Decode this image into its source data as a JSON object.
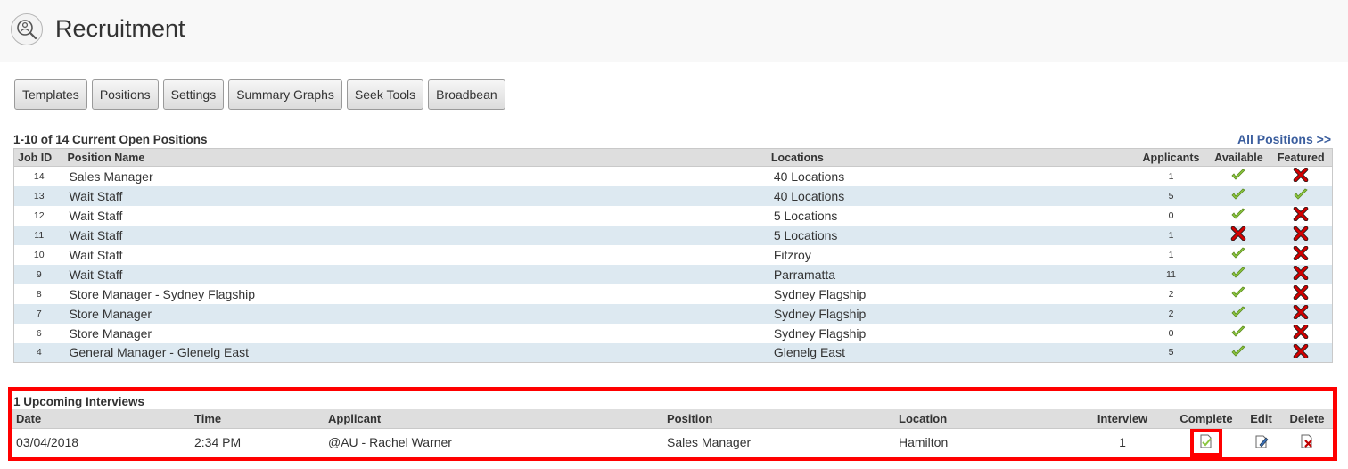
{
  "header": {
    "title": "Recruitment",
    "icon": "recruitment-search-person-icon"
  },
  "toolbar": {
    "buttons": [
      "Templates",
      "Positions",
      "Settings",
      "Summary Graphs",
      "Seek Tools",
      "Broadbean"
    ]
  },
  "positions": {
    "caption": "1-10 of 14 Current Open Positions",
    "all_link": "All Positions >>",
    "columns": {
      "job_id": "Job ID",
      "name": "Position Name",
      "locations": "Locations",
      "applicants": "Applicants",
      "available": "Available",
      "featured": "Featured"
    },
    "rows": [
      {
        "job_id": "14",
        "name": "Sales Manager",
        "locations": "40 Locations",
        "applicants": "1",
        "available": "check-icon",
        "featured": "cross-icon"
      },
      {
        "job_id": "13",
        "name": "Wait Staff",
        "locations": "40 Locations",
        "applicants": "5",
        "available": "check-icon",
        "featured": "check-icon"
      },
      {
        "job_id": "12",
        "name": "Wait Staff",
        "locations": "5 Locations",
        "applicants": "0",
        "available": "check-icon",
        "featured": "cross-icon"
      },
      {
        "job_id": "11",
        "name": "Wait Staff",
        "locations": "5 Locations",
        "applicants": "1",
        "available": "cross-icon",
        "featured": "cross-icon"
      },
      {
        "job_id": "10",
        "name": "Wait Staff",
        "locations": "Fitzroy",
        "applicants": "1",
        "available": "check-icon",
        "featured": "cross-icon"
      },
      {
        "job_id": "9",
        "name": "Wait Staff",
        "locations": "Parramatta",
        "applicants": "11",
        "available": "check-icon",
        "featured": "cross-icon"
      },
      {
        "job_id": "8",
        "name": "Store Manager - Sydney Flagship",
        "locations": "Sydney Flagship",
        "applicants": "2",
        "available": "check-icon",
        "featured": "cross-icon"
      },
      {
        "job_id": "7",
        "name": "Store Manager",
        "locations": "Sydney Flagship",
        "applicants": "2",
        "available": "check-icon",
        "featured": "cross-icon"
      },
      {
        "job_id": "6",
        "name": "Store Manager",
        "locations": "Sydney Flagship",
        "applicants": "0",
        "available": "check-icon",
        "featured": "cross-icon"
      },
      {
        "job_id": "4",
        "name": "General Manager - Glenelg East",
        "locations": "Glenelg East",
        "applicants": "5",
        "available": "check-icon",
        "featured": "cross-icon"
      }
    ]
  },
  "interviews": {
    "caption": "1 Upcoming Interviews",
    "columns": {
      "date": "Date",
      "time": "Time",
      "applicant": "Applicant",
      "position": "Position",
      "location": "Location",
      "interview": "Interview",
      "complete": "Complete",
      "edit": "Edit",
      "delete": "Delete"
    },
    "rows": [
      {
        "date": "03/04/2018",
        "time": "2:34 PM",
        "applicant": "@AU - Rachel Warner",
        "position": "Sales Manager",
        "location": "Hamilton",
        "interview": "1"
      }
    ]
  },
  "colors": {
    "link": "#3b5e9e",
    "row_alt": "#dde9f1",
    "header_bg": "#dedede",
    "check": "#8cc63f",
    "cross": "#d10000",
    "highlight": "#ff0000"
  }
}
